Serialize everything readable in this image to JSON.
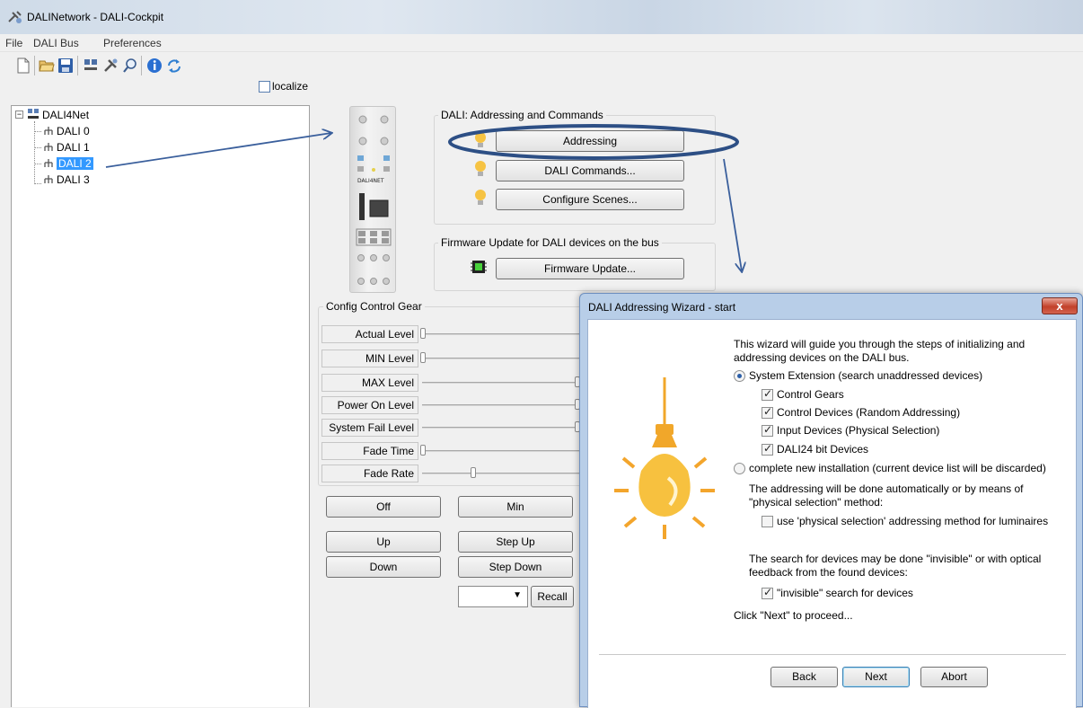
{
  "window": {
    "title": "DALINetwork - DALI-Cockpit"
  },
  "menu": [
    "File",
    "DALI Bus",
    "Preferences"
  ],
  "toolbar_icons": [
    "new-icon",
    "open-icon",
    "save-icon",
    "bus-icon",
    "tools-icon",
    "search-icon",
    "info-icon",
    "refresh-icon"
  ],
  "localize": {
    "label": "localize",
    "checked": false
  },
  "tree": {
    "root": "DALI4Net",
    "children": [
      "DALI 0",
      "DALI 1",
      "DALI 2",
      "DALI 3"
    ],
    "selected": "DALI 2"
  },
  "addressing_group": {
    "title": "DALI: Addressing and Commands",
    "buttons": [
      "Addressing",
      "DALI Commands...",
      "Configure Scenes..."
    ]
  },
  "firmware_group": {
    "title": "Firmware Update for DALI devices on the bus",
    "button": "Firmware Update..."
  },
  "config_gear": {
    "title": "Config Control Gear",
    "rows": [
      {
        "label": "Actual Level",
        "value": 0
      },
      {
        "label": "MIN Level",
        "value": 0
      },
      {
        "label": "MAX Level",
        "value": 1
      },
      {
        "label": "Power On Level",
        "value": 1
      },
      {
        "label": "System Fail Level",
        "value": 1
      },
      {
        "label": "Fade Time",
        "value": 0
      },
      {
        "label": "Fade Rate",
        "value": 0.32
      }
    ]
  },
  "command_buttons": {
    "off": "Off",
    "min": "Min",
    "up": "Up",
    "step_up": "Step Up",
    "down": "Down",
    "step_down": "Step Down",
    "recall": "Recall"
  },
  "dialog": {
    "title": "DALI Addressing Wizard - start",
    "close": "x",
    "intro_line1": "This wizard will guide you through the steps of initializing and",
    "intro_line2": "addressing devices on the DALI bus.",
    "option_extension": "System Extension (search unaddressed devices)",
    "cb_control_gears": "Control Gears",
    "cb_control_devices": "Control Devices (Random Addressing)",
    "cb_input_devices": "Input Devices (Physical Selection)",
    "cb_dali24": "DALI24 bit Devices",
    "option_new": "complete new installation (current device list will be discarded)",
    "addr_line1": "The addressing will be done automatically or by means of",
    "addr_line2": "\"physical selection\" method:",
    "cb_physical": "use 'physical selection' addressing method for luminaires",
    "search_line1": "The search for devices may be done \"invisible\" or with optical",
    "search_line2": "feedback from the found devices:",
    "cb_invisible": "\"invisible\" search for devices",
    "proceed": "Click \"Next\" to proceed...",
    "back": "Back",
    "next": "Next",
    "abort": "Abort"
  },
  "colors": {
    "annotation": "#3a5f9c",
    "selection": "#3399ff",
    "bulb": "#f6b93b"
  }
}
